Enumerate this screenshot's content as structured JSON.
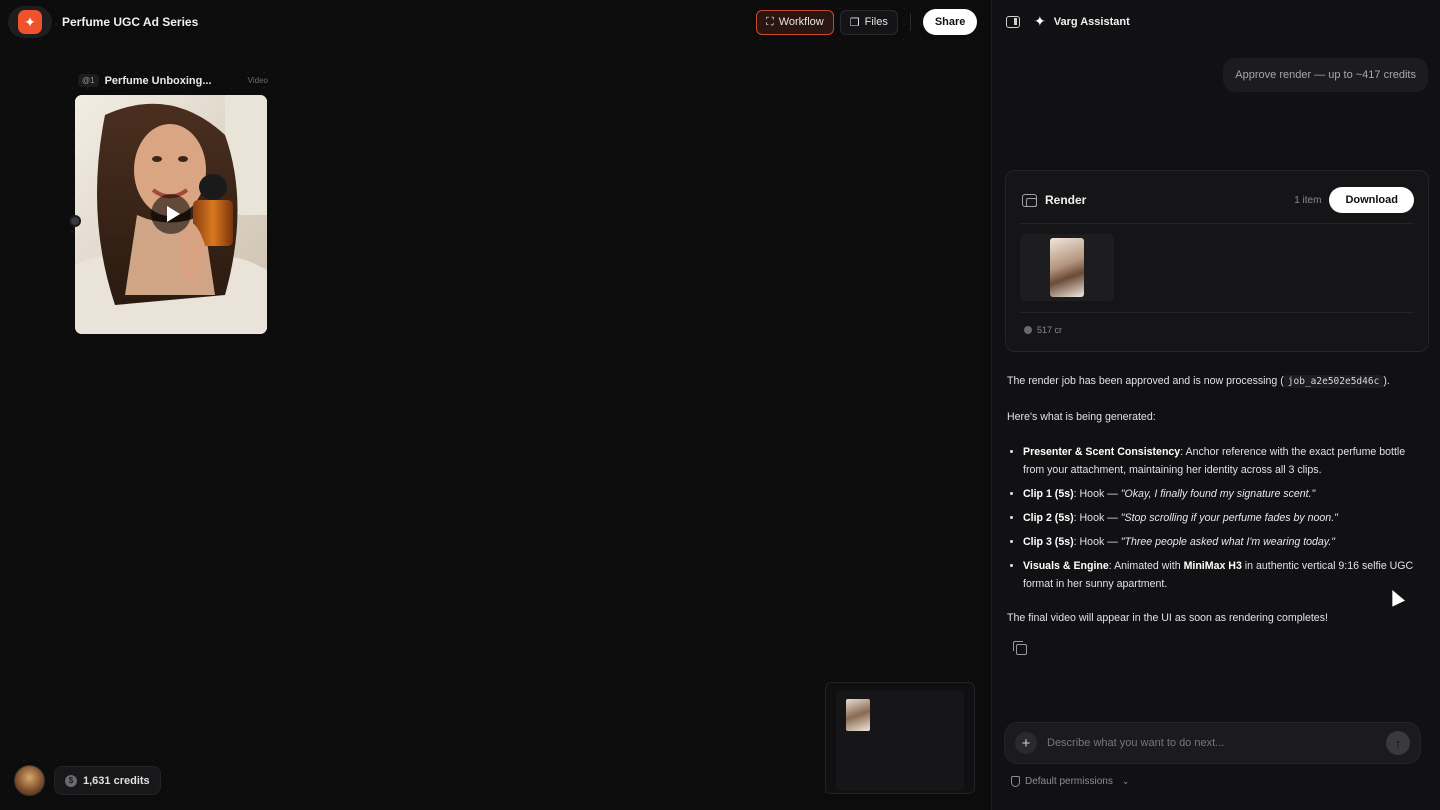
{
  "project": {
    "title": "Perfume UGC Ad Series"
  },
  "toolbar": {
    "workflow": "Workflow",
    "files": "Files",
    "share": "Share"
  },
  "node": {
    "tag": "@1",
    "name": "Perfume Unboxing...",
    "type": "Video"
  },
  "user": {
    "credits": "1,631 credits"
  },
  "assistant": {
    "title": "Varg Assistant",
    "user_message": "Approve render — up to ~417 credits",
    "render": {
      "title": "Render",
      "count": "1 item",
      "download": "Download",
      "cost": "517 cr"
    },
    "reply": {
      "intro_pre": "The render job has been approved and is now processing (",
      "job_id": "job_a2e502e5d46c",
      "intro_post": ").",
      "subhead": "Here's what is being generated:",
      "points": [
        {
          "label": "Presenter & Scent Consistency",
          "text": ": Anchor reference with the exact perfume bottle from your attachment, maintaining her identity across all 3 clips."
        },
        {
          "label": "Clip 1 (5s)",
          "text": ": Hook — ",
          "quote": "\"Okay, I finally found my signature scent.\""
        },
        {
          "label": "Clip 2 (5s)",
          "text": ": Hook — ",
          "quote": "\"Stop scrolling if your perfume fades by noon.\""
        },
        {
          "label": "Clip 3 (5s)",
          "text": ": Hook — ",
          "quote": "\"Three people asked what I'm wearing today.\""
        },
        {
          "label": "Visuals & Engine",
          "text": ": Animated with ",
          "strong": "MiniMax H3",
          "text2": " in authentic vertical 9:16 selfie UGC format in her sunny apartment."
        }
      ],
      "outro": "The final video will appear in the UI as soon as rendering completes!"
    },
    "composer": {
      "placeholder": "Describe what you want to do next..."
    },
    "permissions": "Default permissions"
  }
}
